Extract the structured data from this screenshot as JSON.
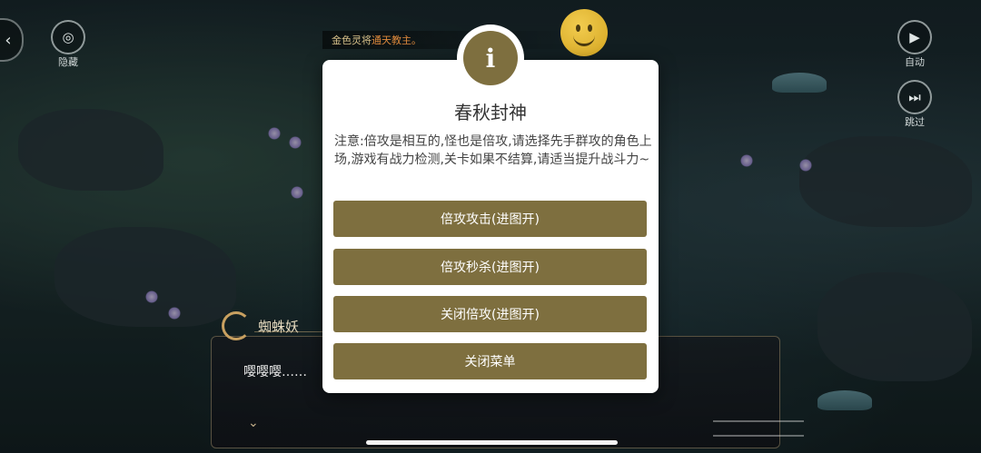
{
  "hud": {
    "hide_label": "隐藏",
    "auto_label": "自动",
    "skip_label": "跳过"
  },
  "banner": {
    "text_prefix": "金色灵将",
    "text_highlight": "通天教主。"
  },
  "dialogue": {
    "speaker": "蜘蛛妖",
    "text": "嘤嘤嘤……"
  },
  "modal": {
    "icon": "i",
    "title": "春秋封神",
    "note": "注意:倍攻是相互的,怪也是倍攻,请选择先手群攻的角色上场,游戏有战力检测,关卡如果不结算,请适当提升战斗力~",
    "buttons": [
      {
        "label": "倍攻攻击(进图开)"
      },
      {
        "label": "倍攻秒杀(进图开)"
      },
      {
        "label": "关闭倍攻(进图开)"
      },
      {
        "label": "关闭菜单"
      }
    ]
  },
  "colors": {
    "accent": "#7e6f3f",
    "modal_bg": "#ffffff"
  }
}
